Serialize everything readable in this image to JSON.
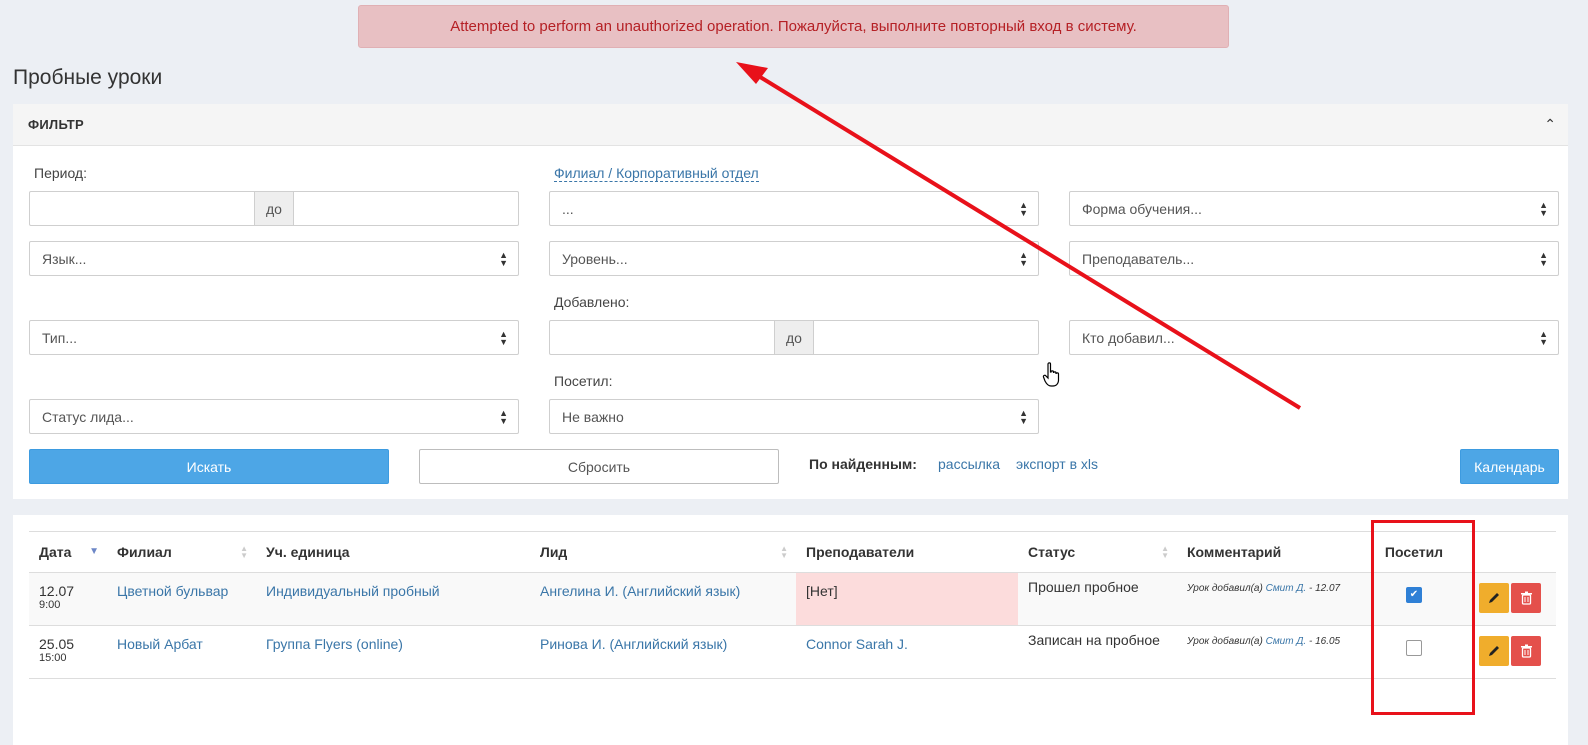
{
  "alert": "Attempted to perform an unauthorized operation. Пожалуйста, выполните повторный вход в систему.",
  "page_title": "Пробные уроки",
  "filter": {
    "header": "ФИЛЬТР",
    "period_label": "Период:",
    "branch_label": "Филиал / Корпоративный отдел",
    "added_label": "Добавлено:",
    "visited_label": "Посетил:",
    "range_sep": "до",
    "branch_value": "...",
    "form_placeholder": "Форма обучения...",
    "language_placeholder": "Язык...",
    "level_placeholder": "Уровень...",
    "teacher_placeholder": "Преподаватель...",
    "type_placeholder": "Тип...",
    "who_added_placeholder": "Кто добавил...",
    "lead_status_placeholder": "Статус лида...",
    "visited_value": "Не важно",
    "search_button": "Искать",
    "reset_button": "Сбросить",
    "found_label": "По найденным:",
    "mailing_link": "рассылка",
    "export_link": "экспорт в xls",
    "calendar_button": "Календарь"
  },
  "table": {
    "headers": [
      "Дата",
      "Филиал",
      "Уч. единица",
      "Лид",
      "Преподаватели",
      "Статус",
      "Комментарий",
      "Посетил"
    ],
    "rows": [
      {
        "date": "12.07",
        "time": "9:00",
        "branch": "Цветной бульвар",
        "unit": "Индивидуальный пробный",
        "lead": "Ангелина И. (Английский язык)",
        "teacher": "[Нет]",
        "status": "Прошел пробное",
        "comment_prefix": "Урок добавил(а)",
        "comment_author": "Смит Д.",
        "comment_date": "- 12.07",
        "visited": true
      },
      {
        "date": "25.05",
        "time": "15:00",
        "branch": "Новый Арбат",
        "unit": "Группа Flyers (online)",
        "lead": "Ринова И. (Английский язык)",
        "teacher": "Connor Sarah J.",
        "status": "Записан на пробное",
        "comment_prefix": "Урок добавил(а)",
        "comment_author": "Смит Д.",
        "comment_date": "- 16.05",
        "visited": false
      }
    ]
  },
  "colors": {
    "alert_bg": "#e8c0c3",
    "alert_text": "#b52025",
    "primary": "#4da6e6",
    "annotation_red": "#e8111a",
    "edit": "#f0ad2c",
    "delete": "#e4504b"
  }
}
